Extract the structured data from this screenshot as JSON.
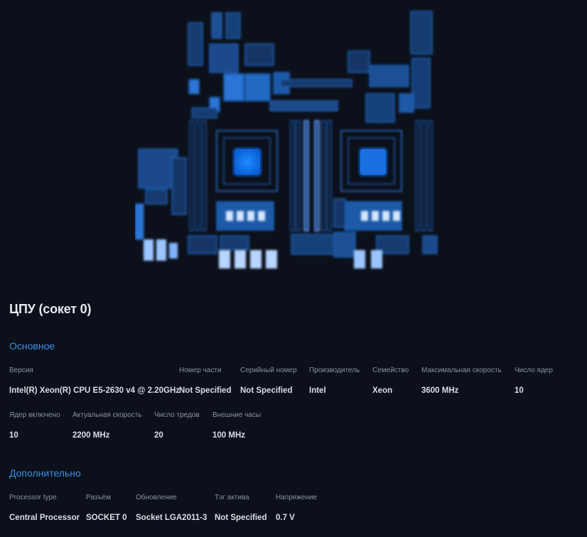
{
  "page": {
    "title": "ЦПУ (сокет 0)"
  },
  "colors": {
    "background": "#0b101a",
    "accent": "#3b8fe6",
    "label": "#8b93a3",
    "value": "#d9dee7",
    "board_blue": "#1e5aa8",
    "cpu_glow": "#0a84ff"
  },
  "image": {
    "icon": "motherboard-illustration"
  },
  "basic": {
    "title": "Основное",
    "fields": [
      {
        "label": "Версия",
        "value": "Intel(R) Xeon(R) CPU E5-2630 v4 @ 2.20GHz"
      },
      {
        "label": "Номер части",
        "value": "Not Specified"
      },
      {
        "label": "Серийный номер",
        "value": "Not Specified"
      },
      {
        "label": "Производитель",
        "value": "Intel"
      },
      {
        "label": "Семейство",
        "value": "Xeon"
      },
      {
        "label": "Максимальная скорость",
        "value": "3600 MHz"
      },
      {
        "label": "Число ядер",
        "value": "10"
      },
      {
        "label": "Ядер включено",
        "value": "10"
      },
      {
        "label": "Актуальная скорость",
        "value": "2200 MHz"
      },
      {
        "label": "Число тредов",
        "value": "20"
      },
      {
        "label": "Внешние часы",
        "value": "100 MHz"
      }
    ]
  },
  "extra": {
    "title": "Дополнительно",
    "fields": [
      {
        "label": "Processor type",
        "value": "Central Processor"
      },
      {
        "label": "Разъём",
        "value": "SOCKET 0"
      },
      {
        "label": "Обновление",
        "value": "Socket LGA2011-3"
      },
      {
        "label": "Тэг актива",
        "value": "Not Specified"
      },
      {
        "label": "Напряжение",
        "value": "0.7 V"
      }
    ]
  }
}
